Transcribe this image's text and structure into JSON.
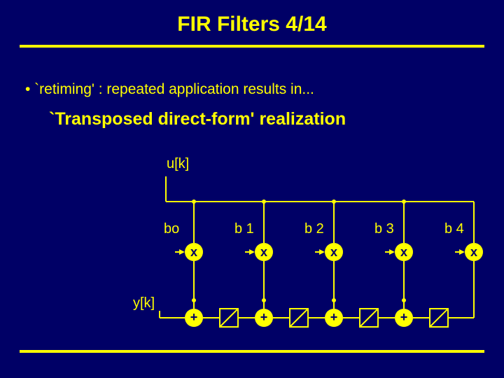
{
  "title": "FIR Filters  4/14",
  "bullet": "•   `retiming' : repeated application results in...",
  "subtitle": "`Transposed direct-form' realization",
  "labels": {
    "input": "u[k]",
    "output": "y[k]",
    "b0": "bo",
    "b1": "b 1",
    "b2": "b 2",
    "b3": "b 3",
    "b4": "b 4"
  },
  "ops": {
    "mul": "x",
    "add": "+"
  },
  "chart_data": {
    "type": "diagram",
    "structure": "Transposed direct-form FIR filter",
    "taps": 5,
    "coefficients": [
      "b0",
      "b1",
      "b2",
      "b3",
      "b4"
    ],
    "multipliers": 5,
    "adders": 4,
    "delays": 4,
    "input_signal": "u[k]",
    "output_signal": "y[k]",
    "signal_flow": "input u[k] broadcast to all multiplier taps; products summed right-to-left through adder chain with unit delays between adders; output y[k] at leftmost adder"
  }
}
